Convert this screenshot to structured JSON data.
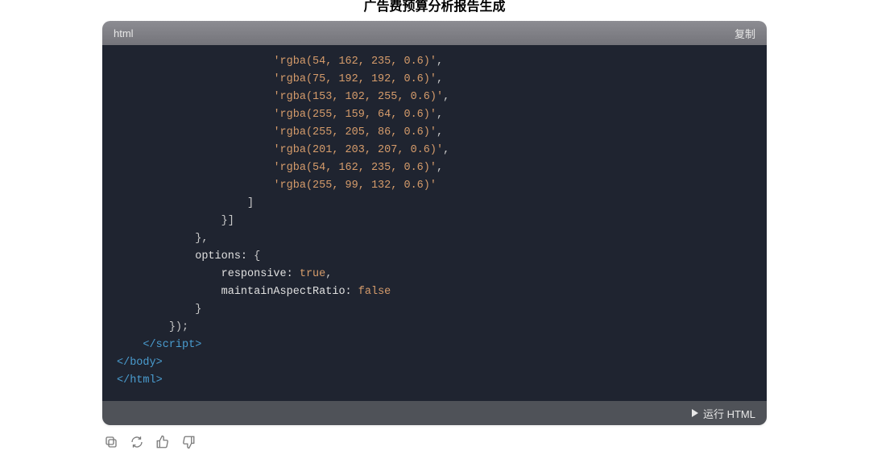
{
  "page": {
    "title": "广告费预算分析报告生成"
  },
  "code_block": {
    "language": "html",
    "copy_label": "复制",
    "run_label": "运行 HTML",
    "lines": [
      {
        "indent": 24,
        "segs": [
          {
            "t": "str",
            "v": "'rgba(54, 162, 235, 0.6)'"
          },
          {
            "t": "punct",
            "v": ","
          }
        ]
      },
      {
        "indent": 24,
        "segs": [
          {
            "t": "str",
            "v": "'rgba(75, 192, 192, 0.6)'"
          },
          {
            "t": "punct",
            "v": ","
          }
        ]
      },
      {
        "indent": 24,
        "segs": [
          {
            "t": "str",
            "v": "'rgba(153, 102, 255, 0.6)'"
          },
          {
            "t": "punct",
            "v": ","
          }
        ]
      },
      {
        "indent": 24,
        "segs": [
          {
            "t": "str",
            "v": "'rgba(255, 159, 64, 0.6)'"
          },
          {
            "t": "punct",
            "v": ","
          }
        ]
      },
      {
        "indent": 24,
        "segs": [
          {
            "t": "str",
            "v": "'rgba(255, 205, 86, 0.6)'"
          },
          {
            "t": "punct",
            "v": ","
          }
        ]
      },
      {
        "indent": 24,
        "segs": [
          {
            "t": "str",
            "v": "'rgba(201, 203, 207, 0.6)'"
          },
          {
            "t": "punct",
            "v": ","
          }
        ]
      },
      {
        "indent": 24,
        "segs": [
          {
            "t": "str",
            "v": "'rgba(54, 162, 235, 0.6)'"
          },
          {
            "t": "punct",
            "v": ","
          }
        ]
      },
      {
        "indent": 24,
        "segs": [
          {
            "t": "str",
            "v": "'rgba(255, 99, 132, 0.6)'"
          }
        ]
      },
      {
        "indent": 20,
        "segs": [
          {
            "t": "punct",
            "v": "]"
          }
        ]
      },
      {
        "indent": 16,
        "segs": [
          {
            "t": "punct",
            "v": "}]"
          }
        ]
      },
      {
        "indent": 12,
        "segs": [
          {
            "t": "punct",
            "v": "},"
          }
        ]
      },
      {
        "indent": 12,
        "segs": [
          {
            "t": "key",
            "v": "options: "
          },
          {
            "t": "punct",
            "v": "{"
          }
        ]
      },
      {
        "indent": 16,
        "segs": [
          {
            "t": "key",
            "v": "responsive: "
          },
          {
            "t": "bool",
            "v": "true"
          },
          {
            "t": "punct",
            "v": ","
          }
        ]
      },
      {
        "indent": 16,
        "segs": [
          {
            "t": "key",
            "v": "maintainAspectRatio: "
          },
          {
            "t": "bool",
            "v": "false"
          }
        ]
      },
      {
        "indent": 12,
        "segs": [
          {
            "t": "punct",
            "v": "}"
          }
        ]
      },
      {
        "indent": 8,
        "segs": [
          {
            "t": "punct",
            "v": "});"
          }
        ]
      },
      {
        "indent": 4,
        "segs": [
          {
            "t": "tag",
            "v": "</script​>"
          }
        ]
      },
      {
        "indent": 0,
        "segs": [
          {
            "t": "tag",
            "v": "</body>"
          }
        ]
      },
      {
        "indent": 0,
        "segs": [
          {
            "t": "tag",
            "v": "</html>"
          }
        ]
      }
    ]
  },
  "actions": {
    "copy": "copy",
    "refresh": "refresh",
    "thumbs_up": "thumbs-up",
    "thumbs_down": "thumbs-down"
  }
}
